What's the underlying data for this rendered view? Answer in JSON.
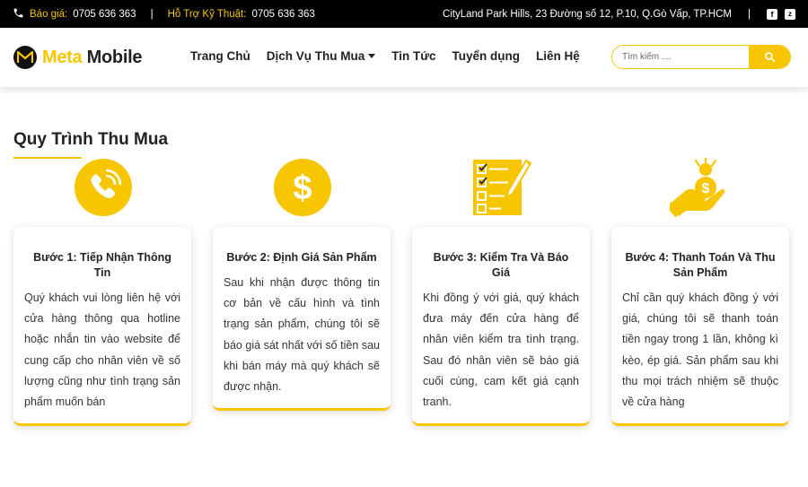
{
  "topbar": {
    "quote_label": "Báo giá:",
    "quote_phone": "0705 636 363",
    "separator": "|",
    "support_label": "Hỗ Trợ Kỹ Thuật:",
    "support_phone": "0705 636 363",
    "address": "CityLand Park Hills, 23 Đường số 12, P.10, Q.Gò Vấp, TP.HCM",
    "facebook_glyph": "f",
    "zalo_glyph": "z"
  },
  "brand": {
    "name_part1": "Meta",
    "name_part2": " Mobile",
    "accent_color": "#f7c600"
  },
  "nav": {
    "home": "Trang Chủ",
    "services": "Dịch Vụ Thu Mua",
    "news": "Tin Tức",
    "careers": "Tuyển dụng",
    "contact": "Liên Hệ"
  },
  "search": {
    "placeholder": "Tìm kiếm ....",
    "value": ""
  },
  "section": {
    "title": "Quy Trình Thu Mua"
  },
  "steps": [
    {
      "icon": "phone-call-icon",
      "title": "Bước 1: Tiếp Nhận Thông Tin",
      "text": "Quý khách vui lòng liên hệ với cửa hàng thông qua hotline hoặc nhắn tin vào website để cung cấp cho nhân viên về số lượng cũng như tình trạng sản phẩm muốn bán"
    },
    {
      "icon": "dollar-coin-icon",
      "title": "Bước 2: Định Giá Sản Phẩm",
      "text": "Sau khi nhận được thông tin cơ bản về cấu hình và tình trạng sản phẩm, chúng tôi sẽ báo giá sát nhất với số tiền sau khi bán máy mà quý khách sẽ được nhận."
    },
    {
      "icon": "checklist-icon",
      "title": "Bước 3: Kiểm Tra Và Báo Giá",
      "text": "Khi đồng ý với giá, quý khách đưa máy đến cửa hàng để nhân viên kiểm tra tình trạng. Sau đó nhân viên sẽ báo giá cuối cùng, cam kết giá cạnh tranh."
    },
    {
      "icon": "hand-money-icon",
      "title": "Bước 4: Thanh Toán Và Thu Sản Phẩm",
      "text": "Chỉ cần quý khách đồng ý với giá, chúng tôi sẽ thanh toán tiền ngay trong 1 lần, không kì kèo, ép giá. Sản phẩm sau khi thu mọi trách nhiệm sẽ thuộc về cửa hàng"
    }
  ]
}
